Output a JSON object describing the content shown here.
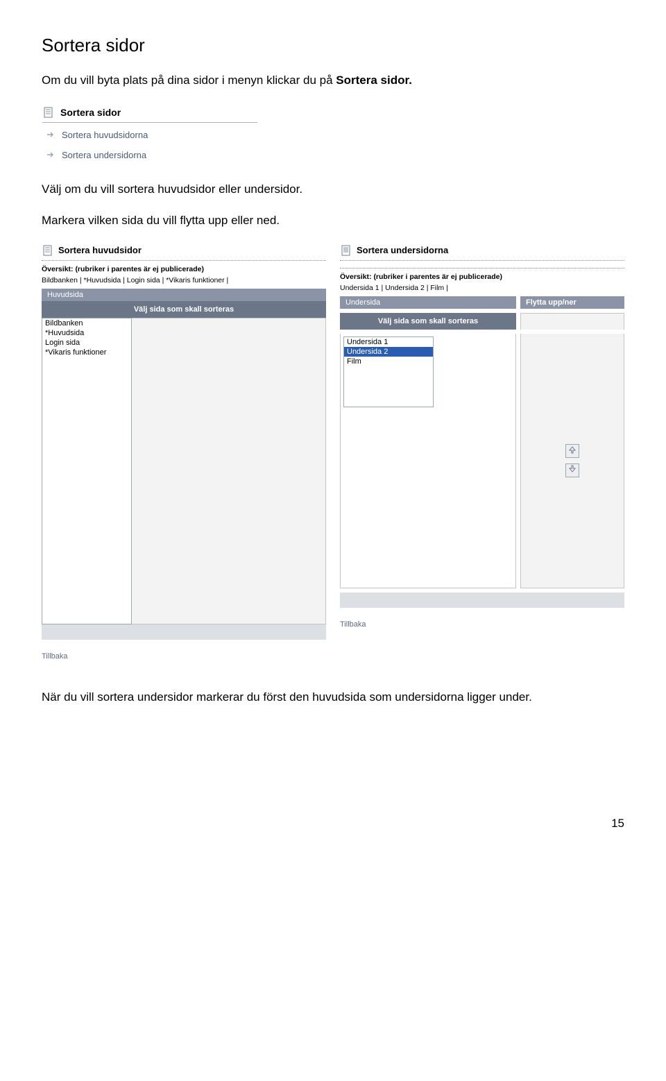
{
  "heading": "Sortera sidor",
  "intro_prefix": "Om du vill byta plats på dina sidor i menyn klickar du på ",
  "intro_bold": "Sortera sidor.",
  "panel1": {
    "title": "Sortera sidor",
    "link1": "Sortera huvudsidorna",
    "link2": "Sortera undersidorna"
  },
  "mid1": "Välj om du vill sortera huvudsidor eller undersidor.",
  "mid2": "Markera vilken sida du vill flytta upp eller ned.",
  "left": {
    "title": "Sortera huvudsidor",
    "overview_label": "Översikt: (rubriker i parentes är ej publicerade)",
    "overview_items": "Bildbanken | *Huvudsida | Login sida | *Vikaris funktioner |",
    "bar": "Huvudsida",
    "sub": "Välj sida som skall sorteras",
    "items": [
      "Bildbanken",
      "*Huvudsida",
      "Login sida",
      "*Vikaris funktioner"
    ],
    "tillbaka": "Tillbaka"
  },
  "right": {
    "title": "Sortera undersidorna",
    "overview_label": "Översikt: (rubriker i parentes är ej publicerade)",
    "overview_items": "Undersida 1 | Undersida 2 | Film |",
    "barL": "Undersida",
    "barR": "Flytta upp/ner",
    "sub": "Välj sida som skall sorteras",
    "items": [
      "Undersida 1",
      "Undersida 2",
      "Film"
    ],
    "selected_index": 1,
    "tillbaka": "Tillbaka"
  },
  "closing": "När du vill sortera undersidor markerar du först den huvudsida som undersidorna ligger under.",
  "page_number": "15"
}
